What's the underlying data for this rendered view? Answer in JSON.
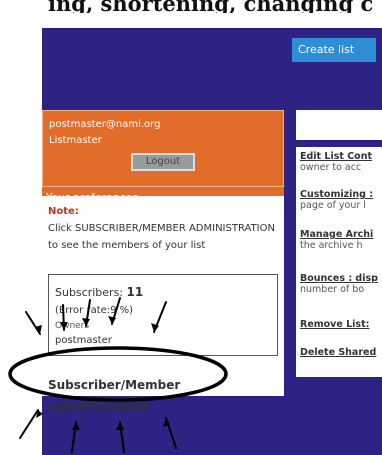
{
  "header": {
    "partial_text": "ing, shortening, changing c",
    "create_list_label": "Create list"
  },
  "login": {
    "email": "postmaster@nami.org",
    "role": "Listmaster",
    "logout_label": "Logout"
  },
  "preferences_link": "Your preferences",
  "note": {
    "title": "Note:",
    "body": "Click SUBSCRIBER/MEMBER ADMINISTRATION to see the members of your list"
  },
  "stats": {
    "subscribers_label": "Subscribers:",
    "subscribers_count": "11",
    "error_rate": "(Error rate:9 %)",
    "owners_label": "Owners",
    "owner_name": "postmaster"
  },
  "admin_link": "Subscriber/Member Administration",
  "right_menu": [
    {
      "title": "Edit List Cont",
      "desc": "owner to acc"
    },
    {
      "title": "Customizing :",
      "desc": "page of your l"
    },
    {
      "title": "Manage Archi",
      "desc": "the archive h"
    },
    {
      "title": "Bounces : disp",
      "desc": "number of bo"
    },
    {
      "title": "Remove List:",
      "desc": ""
    },
    {
      "title": "Delete Shared",
      "desc": ""
    }
  ],
  "colors": {
    "background": "#2c2384",
    "login_box": "#e26d2b",
    "tab": "#2f8fd6",
    "note_title": "#c0301a"
  }
}
